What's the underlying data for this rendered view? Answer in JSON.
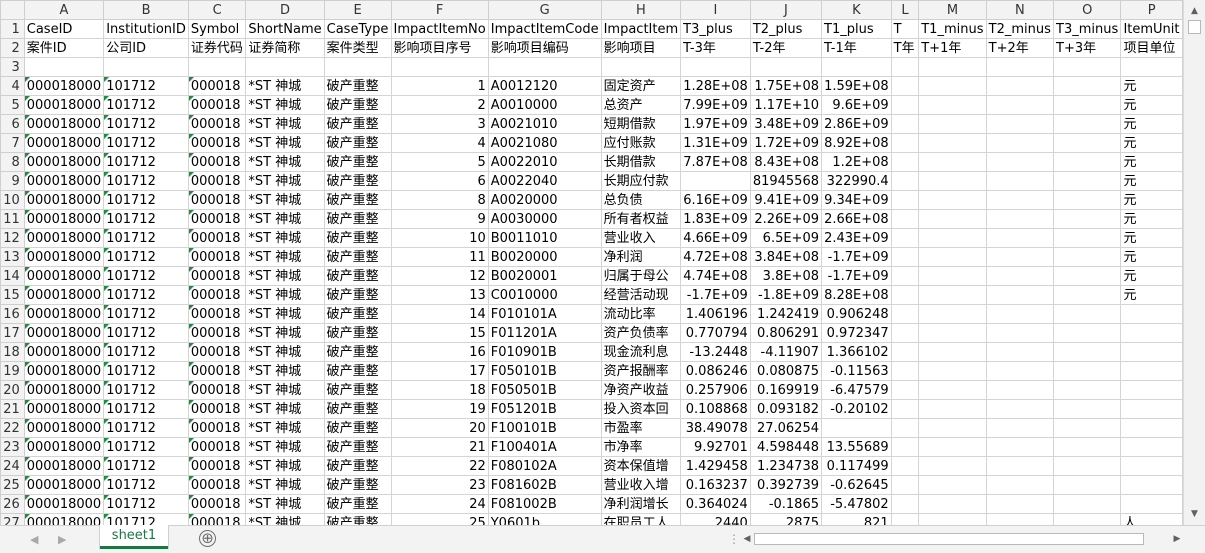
{
  "window": {
    "sheet_tab": "sheet1",
    "add_sheet": "⊕"
  },
  "columns": [
    "A",
    "B",
    "C",
    "D",
    "E",
    "F",
    "G",
    "H",
    "I",
    "J",
    "K",
    "L",
    "M",
    "N",
    "O",
    "P"
  ],
  "header_row1": [
    "CaseID",
    "InstitutionID",
    "Symbol",
    "ShortName",
    "CaseType",
    "ImpactItemNo",
    "ImpactItemCode",
    "ImpactItem",
    "T3_plus",
    "T2_plus",
    "T1_plus",
    "T",
    "T1_minus",
    "T2_minus",
    "T3_minus",
    "ItemUnit"
  ],
  "header_row2": [
    "案件ID",
    "公司ID",
    "证券代码",
    "证券简称",
    "案件类型",
    "影响项目序号",
    "影响项目编码",
    "影响项目",
    "T-3年",
    "T-2年",
    "T-1年",
    "T年",
    "T+1年",
    "T+2年",
    "T+3年",
    "项目单位"
  ],
  "common": {
    "case_id": "000018000",
    "institution_id": "101712",
    "symbol": "000018",
    "short_name": "*ST 神城",
    "case_type": "破产重整"
  },
  "rows": [
    {
      "no": "1",
      "code": "A0012120",
      "item": "固定资产",
      "t3": "1.28E+08",
      "t2": "1.75E+08",
      "t1": "1.59E+08",
      "unit": "元"
    },
    {
      "no": "2",
      "code": "A0010000",
      "item": "总资产",
      "t3": "7.99E+09",
      "t2": "1.17E+10",
      "t1": "9.6E+09",
      "unit": "元"
    },
    {
      "no": "3",
      "code": "A0021010",
      "item": "短期借款",
      "t3": "1.97E+09",
      "t2": "3.48E+09",
      "t1": "2.86E+09",
      "unit": "元"
    },
    {
      "no": "4",
      "code": "A0021080",
      "item": "应付账款",
      "t3": "1.31E+09",
      "t2": "1.72E+09",
      "t1": "8.92E+08",
      "unit": "元"
    },
    {
      "no": "5",
      "code": "A0022010",
      "item": "长期借款",
      "t3": "7.87E+08",
      "t2": "8.43E+08",
      "t1": "1.2E+08",
      "unit": "元"
    },
    {
      "no": "6",
      "code": "A0022040",
      "item": "长期应付款",
      "t3": "",
      "t2": "81945568",
      "t1": "322990.4",
      "unit": "元"
    },
    {
      "no": "8",
      "code": "A0020000",
      "item": "总负债",
      "t3": "6.16E+09",
      "t2": "9.41E+09",
      "t1": "9.34E+09",
      "unit": "元"
    },
    {
      "no": "9",
      "code": "A0030000",
      "item": "所有者权益",
      "t3": "1.83E+09",
      "t2": "2.26E+09",
      "t1": "2.66E+08",
      "unit": "元"
    },
    {
      "no": "10",
      "code": "B0011010",
      "item": "营业收入",
      "t3": "4.66E+09",
      "t2": "6.5E+09",
      "t1": "2.43E+09",
      "unit": "元"
    },
    {
      "no": "11",
      "code": "B0020000",
      "item": "净利润",
      "t3": "4.72E+08",
      "t2": "3.84E+08",
      "t1": "-1.7E+09",
      "unit": "元"
    },
    {
      "no": "12",
      "code": "B0020001",
      "item": "归属于母公",
      "t3": "4.74E+08",
      "t2": "3.8E+08",
      "t1": "-1.7E+09",
      "unit": "元"
    },
    {
      "no": "13",
      "code": "C0010000",
      "item": "经营活动现",
      "t3": "-1.7E+09",
      "t2": "-1.8E+09",
      "t1": "8.28E+08",
      "unit": "元"
    },
    {
      "no": "14",
      "code": "F010101A",
      "item": "流动比率",
      "t3": "1.406196",
      "t2": "1.242419",
      "t1": "0.906248",
      "unit": ""
    },
    {
      "no": "15",
      "code": "F011201A",
      "item": "资产负债率",
      "t3": "0.770794",
      "t2": "0.806291",
      "t1": "0.972347",
      "unit": ""
    },
    {
      "no": "16",
      "code": "F010901B",
      "item": "现金流利息",
      "t3": "-13.2448",
      "t2": "-4.11907",
      "t1": "1.366102",
      "unit": ""
    },
    {
      "no": "17",
      "code": "F050101B",
      "item": "资产报酬率",
      "t3": "0.086246",
      "t2": "0.080875",
      "t1": "-0.11563",
      "unit": ""
    },
    {
      "no": "18",
      "code": "F050501B",
      "item": "净资产收益",
      "t3": "0.257906",
      "t2": "0.169919",
      "t1": "-6.47579",
      "unit": ""
    },
    {
      "no": "19",
      "code": "F051201B",
      "item": "投入资本回",
      "t3": "0.108868",
      "t2": "0.093182",
      "t1": "-0.20102",
      "unit": ""
    },
    {
      "no": "20",
      "code": "F100101B",
      "item": "市盈率",
      "t3": "38.49078",
      "t2": "27.06254",
      "t1": "",
      "unit": ""
    },
    {
      "no": "21",
      "code": "F100401A",
      "item": "市净率",
      "t3": "9.92701",
      "t2": "4.598448",
      "t1": "13.55689",
      "unit": ""
    },
    {
      "no": "22",
      "code": "F080102A",
      "item": "资本保值增",
      "t3": "1.429458",
      "t2": "1.234738",
      "t1": "0.117499",
      "unit": ""
    },
    {
      "no": "23",
      "code": "F081602B",
      "item": "营业收入增",
      "t3": "0.163237",
      "t2": "0.392739",
      "t1": "-0.62645",
      "unit": ""
    },
    {
      "no": "24",
      "code": "F081002B",
      "item": "净利润增长",
      "t3": "0.364024",
      "t2": "-0.1865",
      "t1": "-5.47802",
      "unit": ""
    },
    {
      "no": "25",
      "code": "Y0601b",
      "item": "在职员工人",
      "t3": "2440",
      "t2": "2875",
      "t1": "821",
      "unit": "人"
    }
  ]
}
